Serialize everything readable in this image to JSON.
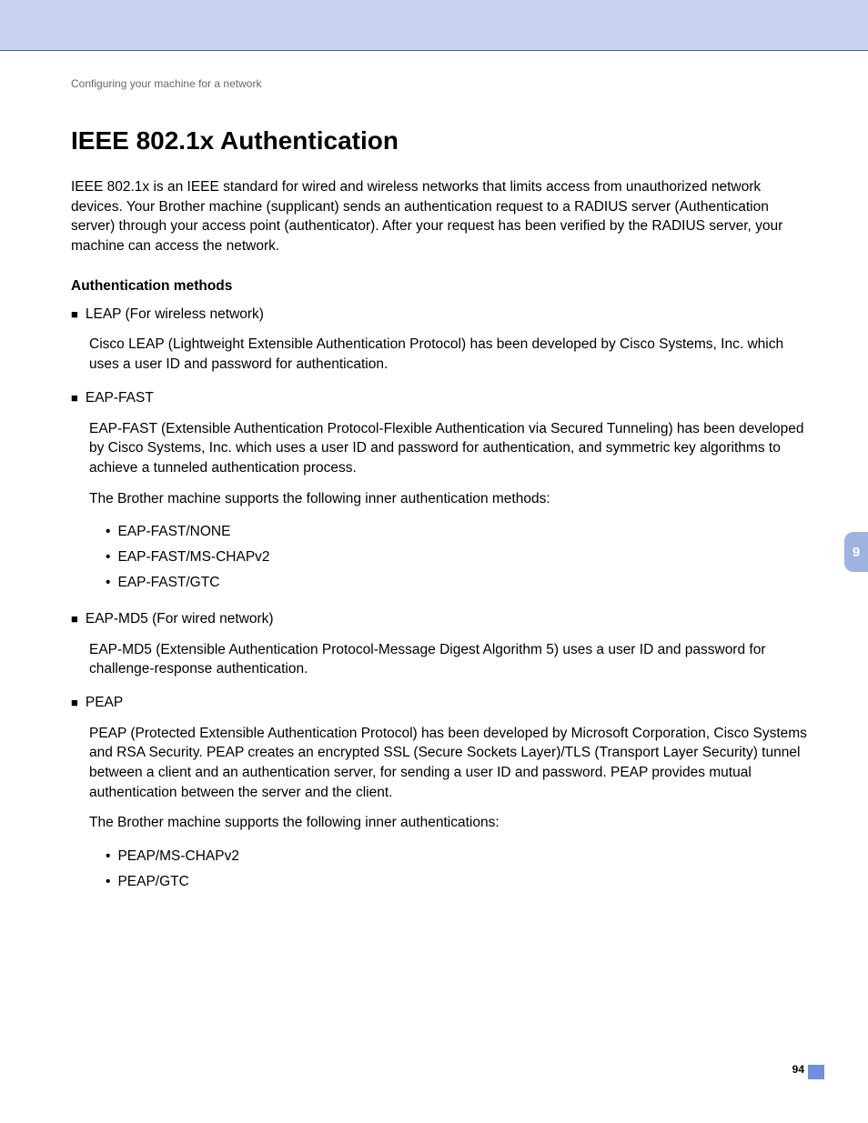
{
  "breadcrumb": "Configuring your machine for a network",
  "title": "IEEE 802.1x Authentication",
  "intro": "IEEE 802.1x is an IEEE standard for wired and wireless networks that limits access from unauthorized network devices. Your Brother machine (supplicant) sends an authentication request to a RADIUS server (Authentication server) through your access point (authenticator). After your request has been verified by the RADIUS server, your machine can access the network.",
  "subhead": "Authentication methods",
  "methods": [
    {
      "title": "LEAP (For wireless network)",
      "paras": [
        "Cisco LEAP (Lightweight Extensible Authentication Protocol) has been developed by Cisco Systems, Inc. which uses a user ID and password for authentication."
      ],
      "inner": []
    },
    {
      "title": "EAP-FAST",
      "paras": [
        "EAP-FAST (Extensible Authentication Protocol-Flexible Authentication via Secured Tunneling) has been developed by Cisco Systems, Inc. which uses a user ID and password for authentication, and symmetric key algorithms to achieve a tunneled authentication process.",
        "The Brother machine supports the following inner authentication methods:"
      ],
      "inner": [
        "EAP-FAST/NONE",
        "EAP-FAST/MS-CHAPv2",
        "EAP-FAST/GTC"
      ]
    },
    {
      "title": "EAP-MD5 (For wired network)",
      "paras": [
        "EAP-MD5 (Extensible Authentication Protocol-Message Digest Algorithm 5) uses a user ID and password for challenge-response authentication."
      ],
      "inner": []
    },
    {
      "title": "PEAP",
      "paras": [
        "PEAP (Protected Extensible Authentication Protocol) has been developed by Microsoft Corporation, Cisco Systems and RSA Security. PEAP creates an encrypted SSL (Secure Sockets Layer)/TLS (Transport Layer Security) tunnel between a client and an authentication server, for sending a user ID and password. PEAP provides mutual authentication between the server and the client.",
        "The Brother machine supports the following inner authentications:"
      ],
      "inner": [
        "PEAP/MS-CHAPv2",
        "PEAP/GTC"
      ]
    }
  ],
  "chapter_tab": "9",
  "page_number": "94"
}
